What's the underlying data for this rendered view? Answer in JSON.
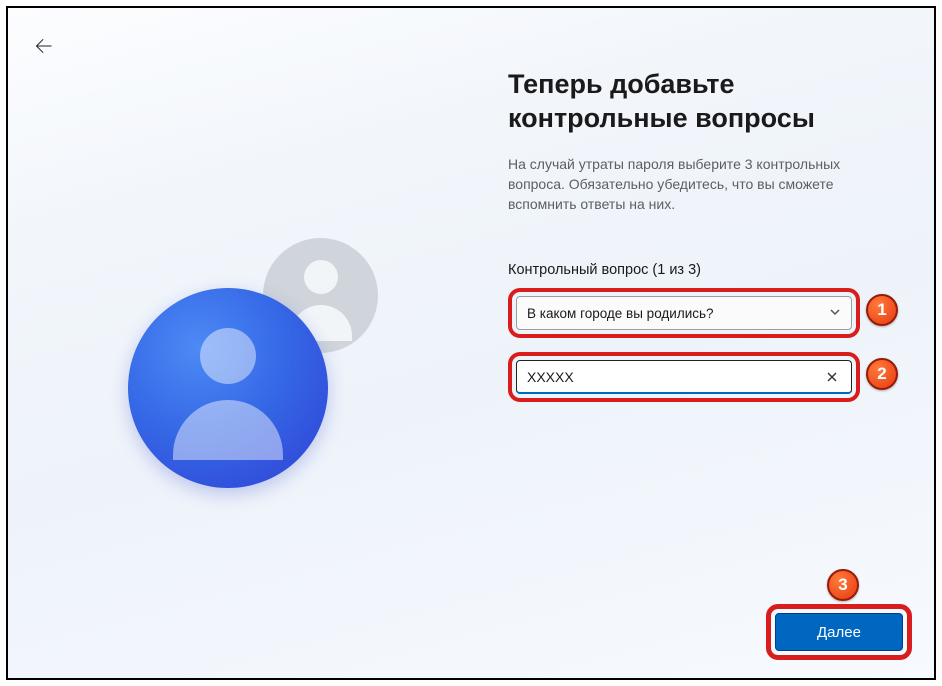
{
  "header": {
    "title": "Теперь добавьте контрольные вопросы",
    "description": "На случай утраты пароля выберите 3 контрольных вопроса. Обязательно убедитесь, что вы сможете вспомнить ответы на них."
  },
  "form": {
    "section_label": "Контрольный вопрос (1 из 3)",
    "question_select": {
      "selected": "В каком городе вы родились?"
    },
    "answer_input": {
      "value": "XXXXX"
    }
  },
  "buttons": {
    "next": "Далее"
  },
  "callouts": {
    "one": "1",
    "two": "2",
    "three": "3"
  }
}
